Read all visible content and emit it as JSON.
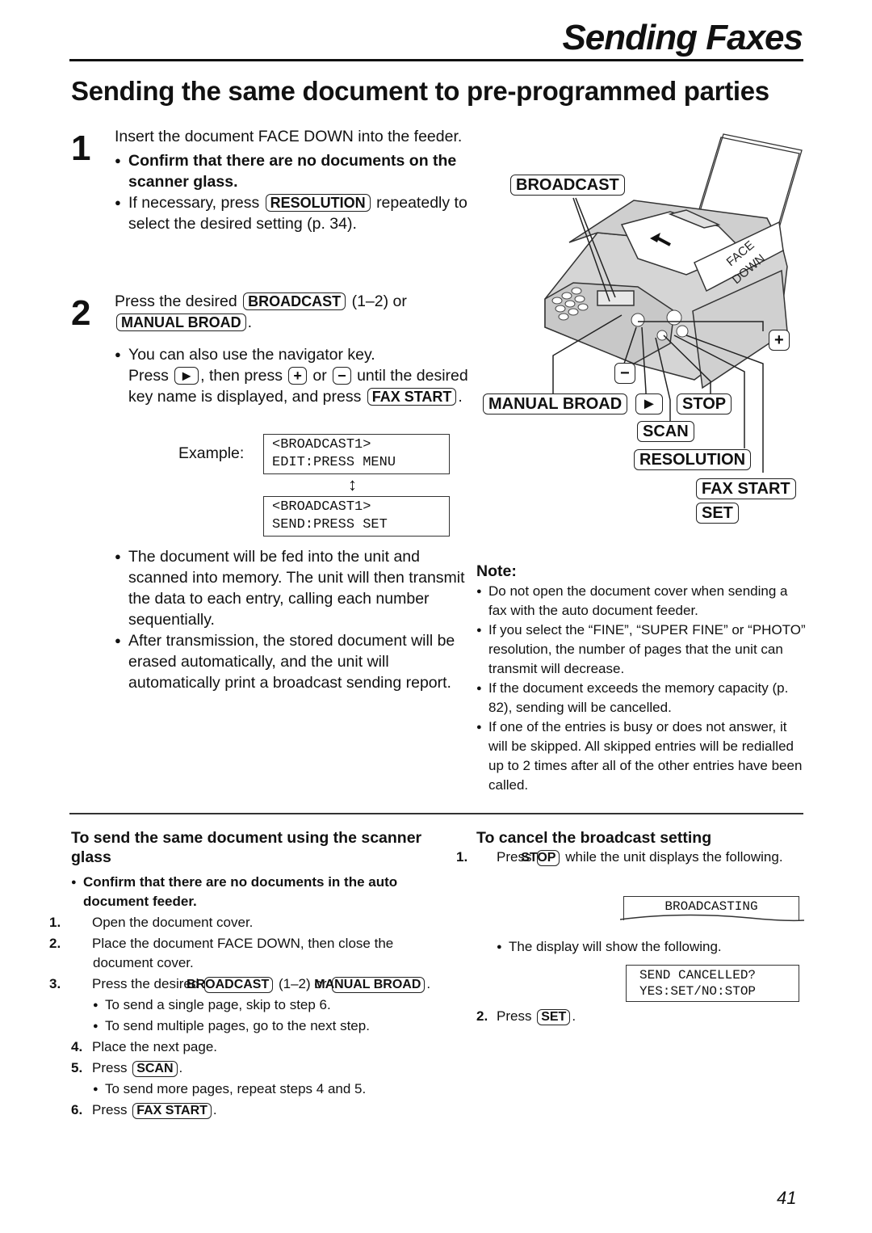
{
  "header": {
    "section_title": "Sending Faxes",
    "page_heading": "Sending the same document to pre-programmed parties"
  },
  "step1": {
    "number": "1",
    "text": "Insert the document FACE DOWN into the feeder.",
    "bullets": [
      "Confirm that there are no documents on the scanner glass."
    ],
    "resolution_prefix": "If necessary, press",
    "resolution_key": "RESOLUTION",
    "resolution_suffix": "repeatedly to select the desired setting (p. 34)."
  },
  "step2": {
    "number": "2",
    "prefix": "Press the desired",
    "broadcast_key": "BROADCAST",
    "middle": "(1–2) or",
    "manual_key": "MANUAL BROAD",
    "end": ".",
    "nav_bullet": "You can also use the navigator key.",
    "nav_press": "Press",
    "nav_play_key": "►",
    "nav_then": ", then press",
    "nav_plus_key": "+",
    "nav_or": "or",
    "nav_minus_key": "−",
    "nav_until": "until the desired key name is displayed, and press",
    "fax_start_key": "FAX START",
    "example_label": "Example:",
    "lcd1": [
      "<BROADCAST1>",
      "EDIT:PRESS MENU"
    ],
    "lcd2": [
      "<BROADCAST1>",
      "SEND:PRESS SET"
    ],
    "bullets": [
      "The document will be fed into the unit and scanned into memory. The unit will then transmit the data to each entry, calling each number sequentially.",
      "After transmission, the stored document will be erased automatically, and the unit will automatically print a broadcast sending report."
    ]
  },
  "diagram": {
    "labels": {
      "broadcast": "BROADCAST",
      "plus": "+",
      "minus": "−",
      "manual_broad": "MANUAL BROAD",
      "play": "►",
      "stop": "STOP",
      "scan": "SCAN",
      "resolution": "RESOLUTION",
      "fax_start": "FAX START",
      "set": "SET"
    },
    "paper_text": [
      "FACE",
      "DOWN"
    ]
  },
  "note": {
    "title": "Note:",
    "bullets": [
      "Do not open the document cover when sending a fax with the auto document feeder.",
      "If you select the “FINE”, “SUPER FINE” or “PHOTO”  resolution, the number of pages that the unit can transmit will decrease.",
      "If the document exceeds the memory capacity (p. 82), sending will be cancelled.",
      "If one of the entries is busy or does not answer, it will be skipped. All skipped entries will be redialled up to 2 times after all of the other entries have been called."
    ]
  },
  "scanner_glass": {
    "heading": "To send the same document using the scanner glass",
    "confirm": "Confirm that there are no documents in the auto document feeder.",
    "steps": [
      {
        "n": "1.",
        "text": "Open the document cover."
      },
      {
        "n": "2.",
        "text": "Place the document FACE DOWN, then close the document cover."
      },
      {
        "n": "3.",
        "prefix": "Press the desired",
        "key1": "BROADCAST",
        "middle": "(1–2) or",
        "key2": "MANUAL BROAD",
        "end": "."
      },
      {
        "n": "4.",
        "text": "Place the next page."
      },
      {
        "n": "5.",
        "prefix": "Press",
        "key": "SCAN",
        "end": "."
      },
      {
        "n": "6.",
        "prefix": "Press",
        "key": "FAX START",
        "end": "."
      }
    ],
    "sub_bullets_3": [
      "To send a single page, skip to step 6.",
      "To send multiple pages, go to the next step."
    ],
    "sub_bullets_5": [
      "To send more pages, repeat steps 4 and 5."
    ]
  },
  "cancel": {
    "heading": "To cancel the broadcast setting",
    "step1_n": "1.",
    "step1_prefix": "Press",
    "step1_key": "STOP",
    "step1_suffix": "while the unit displays the following.",
    "lcd_broadcasting": "BROADCASTING",
    "bullet": "The display will show the following.",
    "lcd_cancel": [
      "SEND CANCELLED?",
      "YES:SET/NO:STOP"
    ],
    "step2_n": "2.",
    "step2_prefix": "Press",
    "step2_key": "SET",
    "step2_end": "."
  },
  "footer": {
    "page_number": "41"
  }
}
